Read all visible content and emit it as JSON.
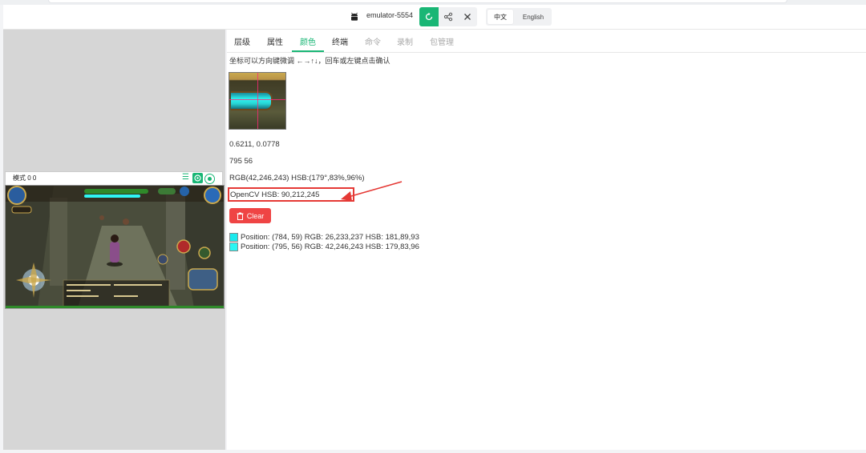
{
  "toolbar": {
    "device": "emulator-5554",
    "lang_zh": "中文",
    "lang_en": "English"
  },
  "phone": {
    "mode_label": "模式 0 0"
  },
  "tabs": [
    {
      "label": "层级",
      "state": "normal"
    },
    {
      "label": "属性",
      "state": "normal"
    },
    {
      "label": "颜色",
      "state": "active"
    },
    {
      "label": "终端",
      "state": "normal"
    },
    {
      "label": "命令",
      "state": "disabled"
    },
    {
      "label": "录制",
      "state": "disabled"
    },
    {
      "label": "包管理",
      "state": "disabled"
    }
  ],
  "color": {
    "hint": "坐标可以方向键微调 ←→↑↓，回车或左键点击确认",
    "relative": "0.6211, 0.0778",
    "absolute": "795 56",
    "rgb_hsb": "RGB(42,246,243) HSB:(179°,83%,96%)",
    "opencv": "OpenCV HSB: 90,212,245",
    "clear_label": "Clear",
    "history": [
      {
        "text": "Position: (784, 59) RGB: 26,233,237 HSB: 181,89,93",
        "color": "#1ae9ed"
      },
      {
        "text": "Position: (795, 56) RGB: 42,246,243 HSB: 179,83,96",
        "color": "#2af6f3"
      }
    ]
  },
  "colors": {
    "accent": "#19b675",
    "danger": "#ef4444",
    "highlight_box": "#e53935"
  }
}
